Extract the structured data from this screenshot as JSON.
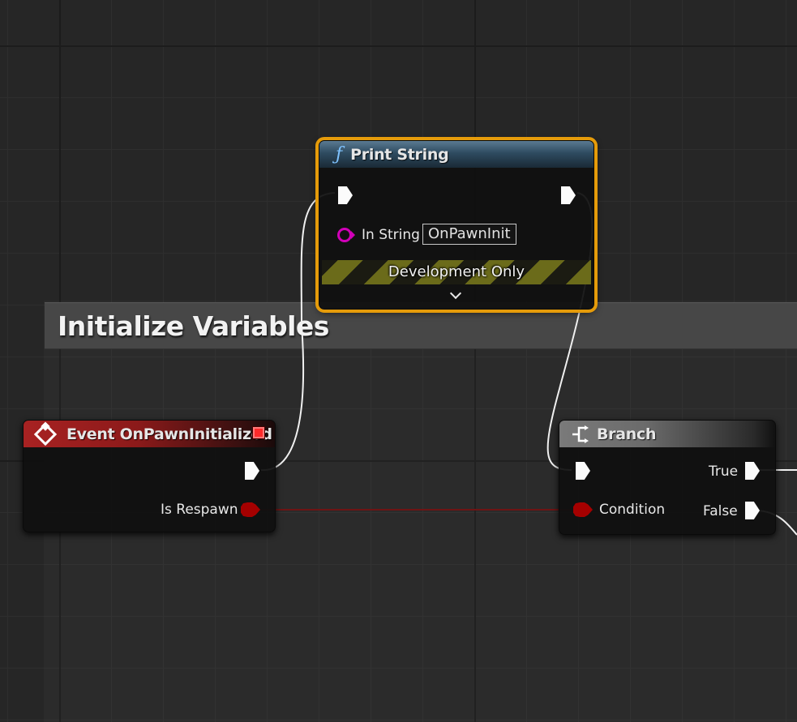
{
  "comment": {
    "title": "Initialize Variables"
  },
  "nodes": {
    "print_string": {
      "title": "Print String",
      "in_string_label": "In String",
      "in_string_value": "OnPawnInit",
      "dev_only_label": "Development Only",
      "header_icon": "function-icon",
      "expand_icon": "chevron-down-icon"
    },
    "event": {
      "title": "Event OnPawnInitialized",
      "output_label": "Is Respawn",
      "header_icon": "event-diamond-icon",
      "delegate_icon": "delegate-square-icon"
    },
    "branch": {
      "title": "Branch",
      "condition_label": "Condition",
      "true_label": "True",
      "false_label": "False",
      "header_icon": "branch-icon"
    }
  },
  "colors": {
    "background": "#262626",
    "event_header": "#a31b1b",
    "function_header": "#2f4a5e",
    "branch_header": "#6e6e6e",
    "bool_pin": "#a50000",
    "selection_outline": "#e59b0a",
    "string_pin": "#d100b8"
  }
}
